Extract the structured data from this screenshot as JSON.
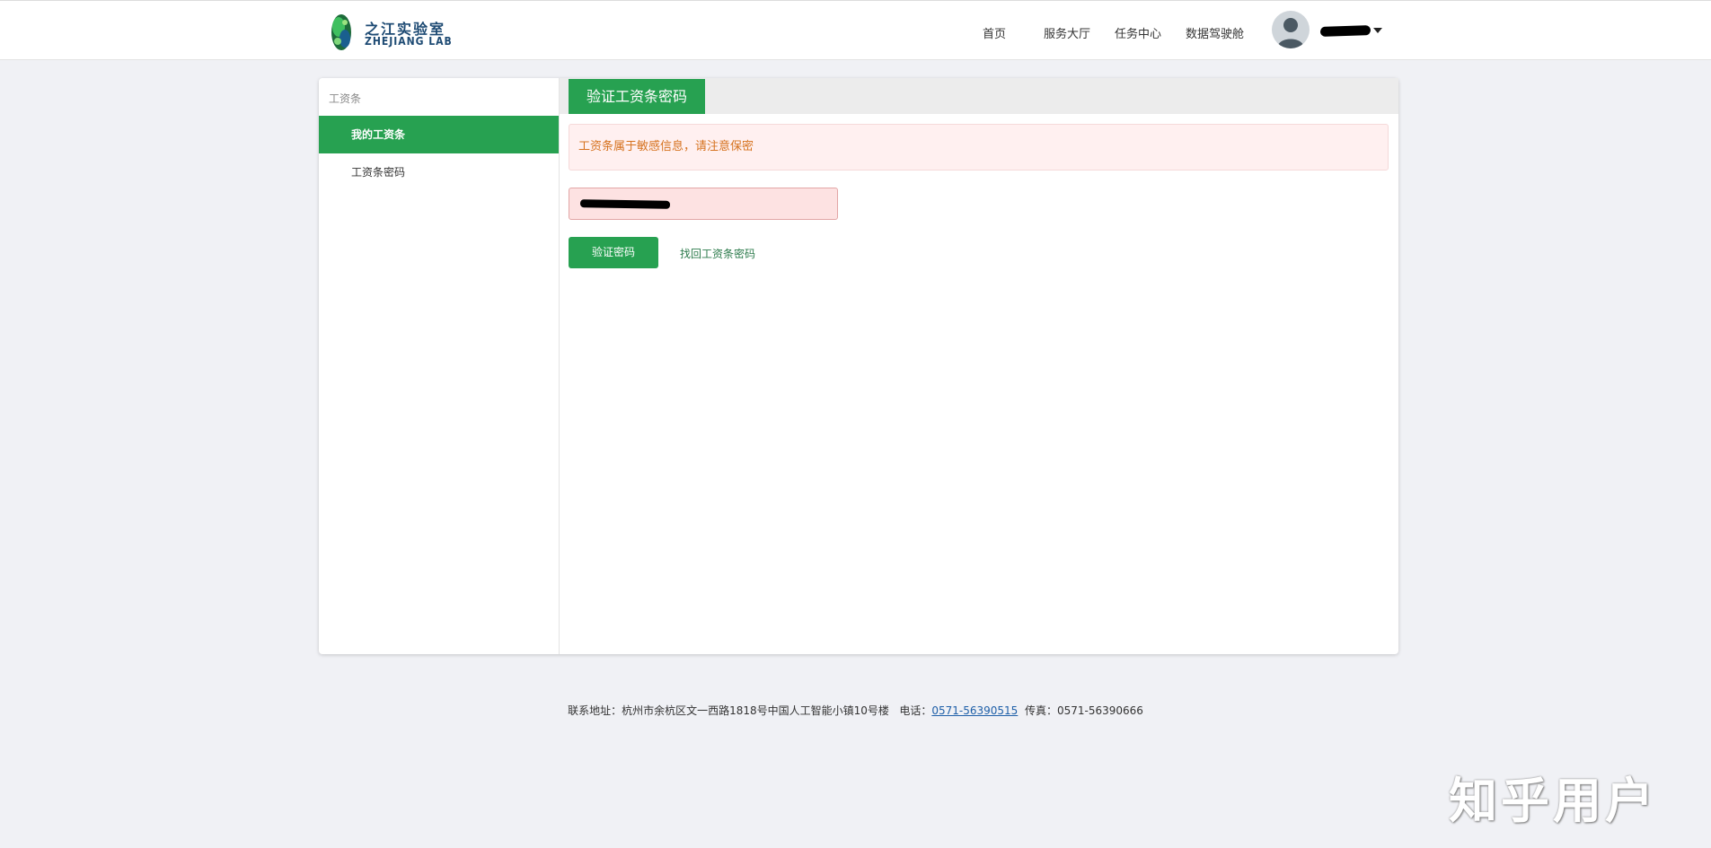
{
  "header": {
    "logo_cn": "之江实验室",
    "logo_en": "ZHEJIANG LAB",
    "nav": [
      "首页",
      "服务大厅",
      "任务中心",
      "数据驾驶舱"
    ]
  },
  "sidebar": {
    "title": "工资条",
    "items": [
      {
        "label": "我的工资条",
        "active": true
      },
      {
        "label": "工资条密码",
        "active": false
      }
    ]
  },
  "content": {
    "tab_label": "验证工资条密码",
    "alert_text": "工资条属于敏感信息，请注意保密",
    "verify_button": "验证密码",
    "recover_link": "找回工资条密码"
  },
  "footer": {
    "address": "联系地址：杭州市余杭区文一西路1818号中国人工智能小镇10号楼",
    "phone_label": "电话：",
    "phone": "0571-56390515",
    "fax": "传真：0571-56390666"
  },
  "watermark": "知乎用户",
  "colors": {
    "primary": "#27a151",
    "alert_text": "#d6721e",
    "background": "#f0f1f5"
  },
  "icons": {
    "avatar": "user-avatar-icon",
    "dropdown": "caret-down-icon",
    "logo": "zhejiang-lab-logo"
  }
}
